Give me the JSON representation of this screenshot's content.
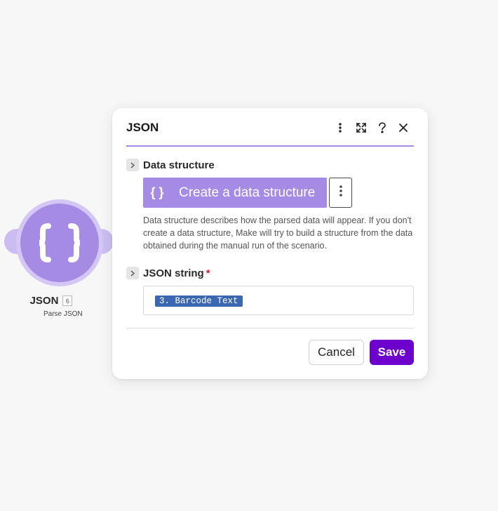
{
  "node": {
    "title": "JSON",
    "badge": "6",
    "subtitle": "Parse JSON",
    "icon": "json-braces-icon",
    "color": "#a58be3"
  },
  "dialog": {
    "title": "JSON",
    "header_icons": [
      "more-vertical-icon",
      "expand-icon",
      "help-icon",
      "close-icon"
    ],
    "data_structure": {
      "label": "Data structure",
      "button_icon": "{ }",
      "button_label": "Create a data structure",
      "description": "Data structure describes how the parsed data will appear. If you don't create a data structure, Make will try to build a structure from the data obtained during the manual run of the scenario."
    },
    "json_string": {
      "label": "JSON string",
      "required_mark": "*",
      "value_pill": "3. Barcode Text"
    },
    "buttons": {
      "cancel": "Cancel",
      "save": "Save"
    }
  },
  "colors": {
    "accent": "#a58be3",
    "save": "#6d00cc",
    "pill": "#3a66b2",
    "required": "#d1242f"
  }
}
